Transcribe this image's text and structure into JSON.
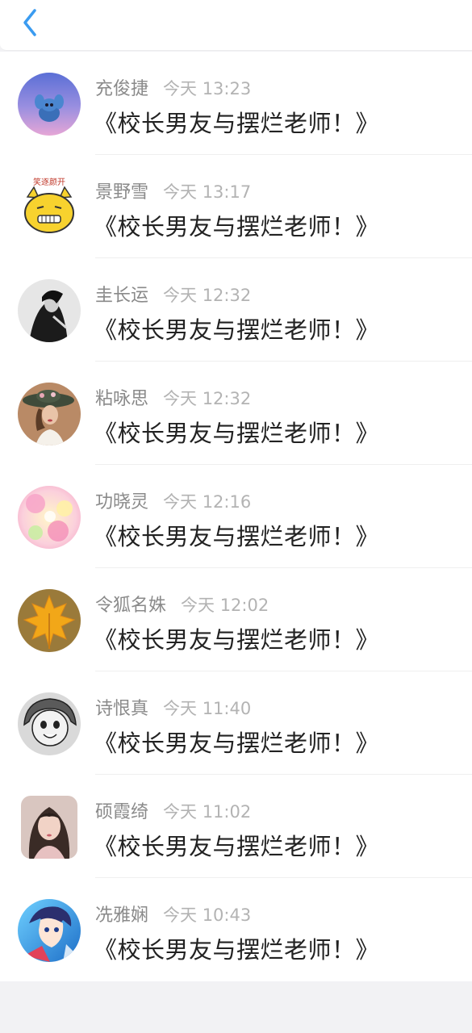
{
  "header": {
    "back_icon": "chevron-left-icon"
  },
  "comments": [
    {
      "user": "充俊捷",
      "time": "今天 13:23",
      "text": "《校长男友与摆烂老师！》",
      "avatar": "stitch-avatar"
    },
    {
      "user": "景野雪",
      "time": "今天 13:17",
      "text": "《校长男友与摆烂老师！》",
      "avatar": "cartoon-cat-avatar",
      "avatar_caption": "笑逐颜开"
    },
    {
      "user": "圭长运",
      "time": "今天 12:32",
      "text": "《校长男友与摆烂老师！》",
      "avatar": "bw-portrait-avatar"
    },
    {
      "user": "粘咏思",
      "time": "今天 12:32",
      "text": "《校长男友与摆烂老师！》",
      "avatar": "hat-woman-avatar"
    },
    {
      "user": "功晓灵",
      "time": "今天 12:16",
      "text": "《校长男友与摆烂老师！》",
      "avatar": "flowers-avatar"
    },
    {
      "user": "令狐名姝",
      "time": "今天 12:02",
      "text": "《校长男友与摆烂老师！》",
      "avatar": "maple-leaf-avatar"
    },
    {
      "user": "诗恨真",
      "time": "今天 11:40",
      "text": "《校长男友与摆烂老师！》",
      "avatar": "manga-avatar"
    },
    {
      "user": "硕霞绮",
      "time": "今天 11:02",
      "text": "《校长男友与摆烂老师！》",
      "avatar": "girl-photo-avatar"
    },
    {
      "user": "冼雅娴",
      "time": "今天 10:43",
      "text": "《校长男友与摆烂老师！》",
      "avatar": "anime-boy-avatar"
    }
  ],
  "colors": {
    "accent": "#3a9bf0",
    "name": "#8a8a8a",
    "time": "#b3b3b3",
    "text": "#222222"
  }
}
